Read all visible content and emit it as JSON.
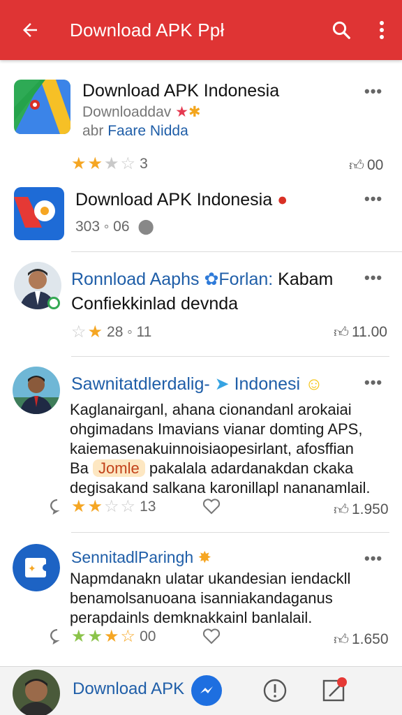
{
  "appbar": {
    "title": "Download APK Ppł",
    "back_icon": "arrow-left-icon",
    "search_icon": "search-icon",
    "menu_icon": "more-vertical-icon",
    "color": "#df3434"
  },
  "items": [
    {
      "title": "Download APK Indonesia",
      "subtitle": "Downloaddav",
      "subtitle2": "abr",
      "subtitle2_link": "Faare Nidda",
      "rating_count": "3",
      "right_count": "00",
      "icon": "maps-app-icon"
    },
    {
      "title": "Download APK Indonesia",
      "meta": "303 ◦ 06",
      "icon": "chat-app-icon"
    },
    {
      "title_blue": "Ronnload Aaphs",
      "title_blue2": "Forlan:",
      "title_rest": "Kabam",
      "line2": "Confiekkinlad devnda",
      "rating_count": "28 ◦ 11",
      "right_count": "11.00",
      "avatar": "man-in-suit-avatar"
    },
    {
      "title_blue": "Sawnitatdlerdalig-",
      "title_blue2": "Indonesi",
      "body_line1": "Kaglanairganl, ahana cionandanl arokaiai",
      "body_line2": "ohgimadans Imavians vianar domting APS,",
      "body_line3": "kaiemasenakuinnoisiaopesirlant, afosffian",
      "body_line4_pre": "Ba",
      "body_chip": "Jomle",
      "body_line4_post": "pakalala adardanakdan ckaka",
      "body_line5": "degisakand salkana karonillapl nananamlail.",
      "rating_count": "13",
      "right_count": "1.950",
      "avatar": "man-in-suit-avatar"
    },
    {
      "title_blue": "SennitadlParingh",
      "body_line1": "Napmdanakn ulatar ukandesian iendackll",
      "body_line2": "benamolsanuoana isanniakandaganus",
      "body_line3": "perapdainls demknakkainl banlalail.",
      "rating_count": "00",
      "right_count": "1.650",
      "avatar": "puzzle-app-icon"
    }
  ],
  "bottombar": {
    "label": "Download APK",
    "avatar": "man-avatar",
    "badge_icon": "messenger-icon",
    "info_icon": "info-circle-icon",
    "edit_icon": "edit-note-icon"
  }
}
